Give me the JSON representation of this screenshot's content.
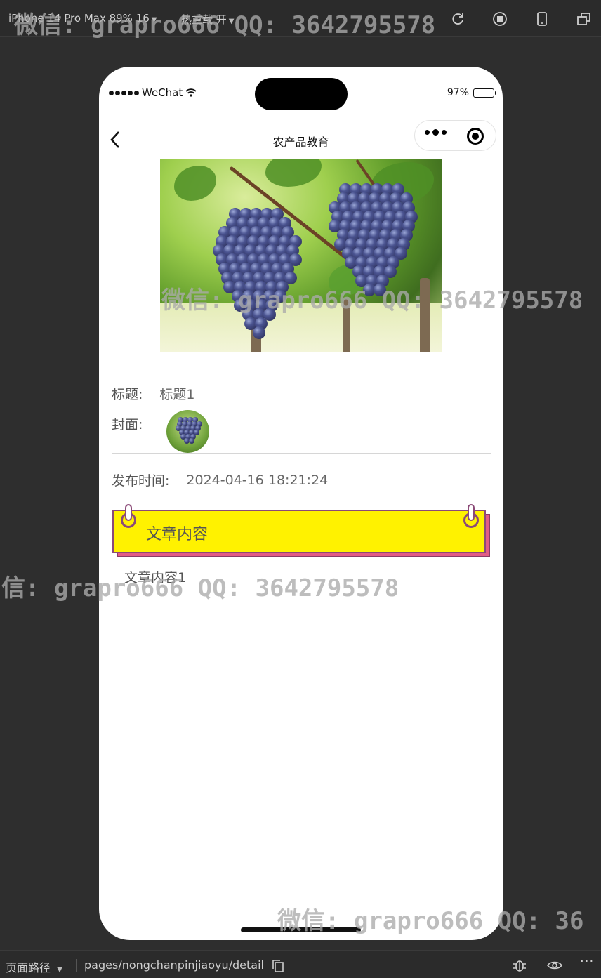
{
  "devtools": {
    "device_label": "iPhone 14 Pro Max 89% 16",
    "hot_reload_label": "热重载 开",
    "path_label": "页面路径",
    "page_path": "pages/nongchanpinjiaoyu/detail"
  },
  "status_bar": {
    "carrier": "WeChat",
    "battery": "97%"
  },
  "navbar": {
    "title": "农产品教育"
  },
  "detail": {
    "title_label": "标题:",
    "title_value": "标题1",
    "cover_label": "封面:",
    "publish_label": "发布时间:",
    "publish_value": "2024-04-16 18:21:24",
    "content_header": "文章内容",
    "content_value": "文章内容1"
  },
  "watermark": {
    "text_top": "微信: grapro666 QQ: 3642795578",
    "text_mid": "微信: grapro666 QQ: 3642795578",
    "text_left": "信: grapro666 QQ: 3642795578",
    "text_bottom": "微信: grapro666 QQ: 36"
  },
  "colors": {
    "note_yellow": "#fff200",
    "note_shadow_pink": "#e25d86",
    "note_border": "#8b4a78"
  }
}
